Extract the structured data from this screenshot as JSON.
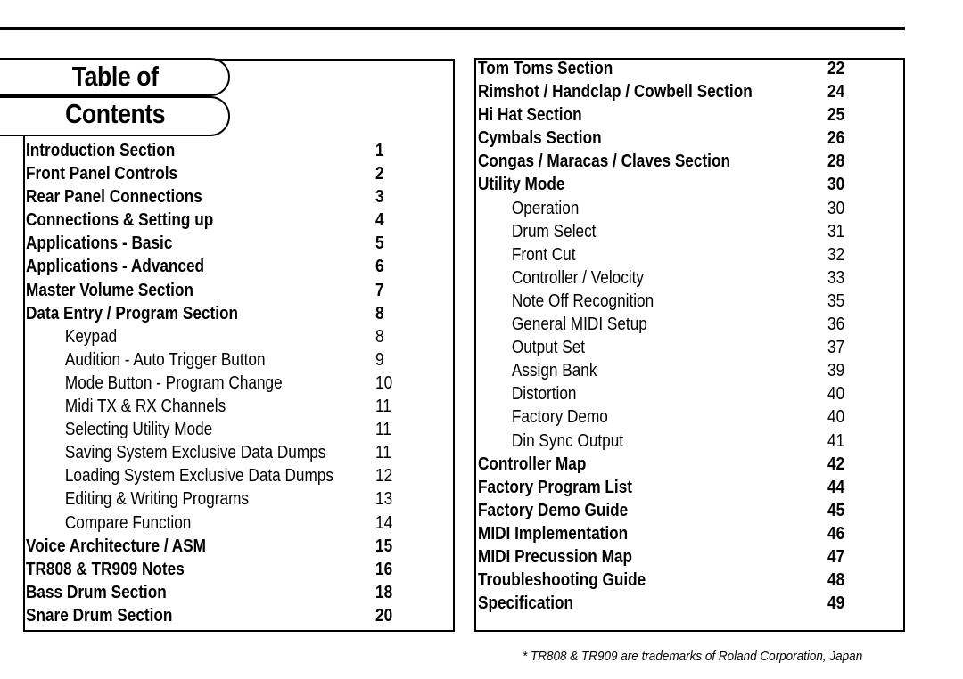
{
  "title": {
    "line1": "Table of",
    "line2": "Contents"
  },
  "toc_left": [
    {
      "title": "Introduction Section",
      "page": "1",
      "level": "main"
    },
    {
      "title": "Front Panel Controls",
      "page": "2",
      "level": "main"
    },
    {
      "title": "Rear Panel Connections",
      "page": "3",
      "level": "main"
    },
    {
      "title": "Connections & Setting up",
      "page": "4",
      "level": "main"
    },
    {
      "title": "Applications - Basic",
      "page": "5",
      "level": "main"
    },
    {
      "title": "Applications - Advanced",
      "page": "6",
      "level": "main"
    },
    {
      "title": "Master Volume Section",
      "page": "7",
      "level": "main"
    },
    {
      "title": "Data Entry / Program Section",
      "page": "8",
      "level": "main"
    },
    {
      "title": "Keypad",
      "page": "8",
      "level": "sub"
    },
    {
      "title": "Audition - Auto Trigger Button",
      "page": "9",
      "level": "sub"
    },
    {
      "title": "Mode Button - Program Change",
      "page": "10",
      "level": "sub"
    },
    {
      "title": "Midi TX & RX Channels",
      "page": "11",
      "level": "sub"
    },
    {
      "title": "Selecting Utility Mode",
      "page": "11",
      "level": "sub"
    },
    {
      "title": "Saving System Exclusive Data Dumps",
      "page": "11",
      "level": "sub"
    },
    {
      "title": "Loading System Exclusive Data Dumps",
      "page": "12",
      "level": "sub"
    },
    {
      "title": "Editing & Writing Programs",
      "page": "13",
      "level": "sub"
    },
    {
      "title": "Compare Function",
      "page": "14",
      "level": "sub"
    },
    {
      "title": "Voice Architecture / ASM",
      "page": "15",
      "level": "main"
    },
    {
      "title": "TR808 & TR909 Notes",
      "page": "16",
      "level": "main"
    },
    {
      "title": "Bass Drum Section",
      "page": "18",
      "level": "main"
    },
    {
      "title": "Snare Drum Section",
      "page": "20",
      "level": "main"
    }
  ],
  "toc_right": [
    {
      "title": "Tom Toms Section",
      "page": "22",
      "level": "main"
    },
    {
      "title": "Rimshot / Handclap / Cowbell Section",
      "page": "24",
      "level": "main"
    },
    {
      "title": "Hi Hat Section",
      "page": "25",
      "level": "main"
    },
    {
      "title": "Cymbals Section",
      "page": "26",
      "level": "main"
    },
    {
      "title": "Congas / Maracas / Claves Section",
      "page": "28",
      "level": "main"
    },
    {
      "title": "Utility Mode",
      "page": "30",
      "level": "main"
    },
    {
      "title": "Operation",
      "page": "30",
      "level": "sub"
    },
    {
      "title": "Drum Select",
      "page": "31",
      "level": "sub"
    },
    {
      "title": "Front Cut",
      "page": "32",
      "level": "sub"
    },
    {
      "title": "Controller / Velocity",
      "page": "33",
      "level": "sub"
    },
    {
      "title": "Note Off Recognition",
      "page": "35",
      "level": "sub"
    },
    {
      "title": "General MIDI Setup",
      "page": "36",
      "level": "sub"
    },
    {
      "title": "Output Set",
      "page": "37",
      "level": "sub"
    },
    {
      "title": "Assign Bank",
      "page": "39",
      "level": "sub"
    },
    {
      "title": "Distortion",
      "page": "40",
      "level": "sub"
    },
    {
      "title": "Factory Demo",
      "page": "40",
      "level": "sub"
    },
    {
      "title": "Din Sync Output",
      "page": "41",
      "level": "sub"
    },
    {
      "title": "Controller Map",
      "page": "42",
      "level": "main"
    },
    {
      "title": "Factory Program List",
      "page": "44",
      "level": "main"
    },
    {
      "title": "Factory Demo Guide",
      "page": "45",
      "level": "main"
    },
    {
      "title": "MIDI Implementation",
      "page": "46",
      "level": "main"
    },
    {
      "title": "MIDI Precussion Map",
      "page": "47",
      "level": "main"
    },
    {
      "title": "Troubleshooting Guide",
      "page": "48",
      "level": "main"
    },
    {
      "title": "Specification",
      "page": "49",
      "level": "main"
    }
  ],
  "footnote": "* TR808 & TR909 are trademarks of Roland Corporation, Japan"
}
